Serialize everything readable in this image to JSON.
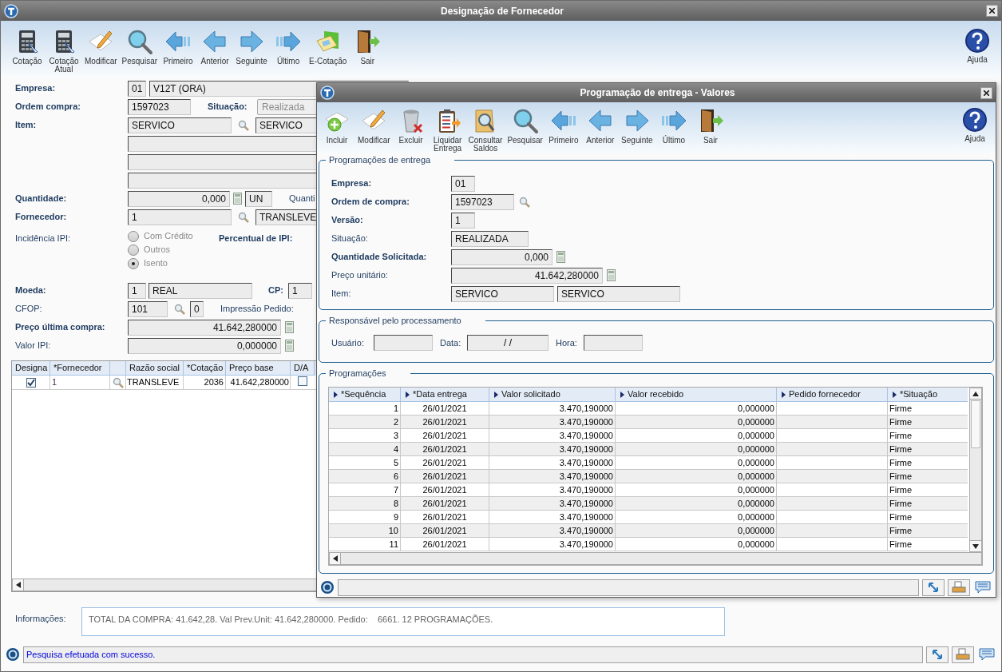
{
  "window": {
    "title": "Designação de Fornecedor"
  },
  "toolbar": [
    {
      "label": "Cotação",
      "kind": "calculator"
    },
    {
      "label": "Cotação\nAtual",
      "kind": "calculator"
    },
    {
      "label": "Modificar",
      "kind": "pencil"
    },
    {
      "label": "Pesquisar",
      "kind": "search"
    },
    {
      "label": "Primeiro",
      "kind": "first"
    },
    {
      "label": "Anterior",
      "kind": "previous"
    },
    {
      "label": "Seguinte",
      "kind": "next"
    },
    {
      "label": "Último",
      "kind": "last"
    },
    {
      "label": "E-Cotação",
      "kind": "folder"
    },
    {
      "label": "Sair",
      "kind": "exit"
    }
  ],
  "help": {
    "label": "Ajuda"
  },
  "form": {
    "empresa": {
      "label": "Empresa:",
      "required": true,
      "code": "01",
      "name": "V12T (ORA)"
    },
    "ordem": {
      "label": "Ordem compra:",
      "required": true,
      "value": "1597023"
    },
    "situacao": {
      "label": "Situação:",
      "required": true,
      "value": "Realizada"
    },
    "item": {
      "label": "Item:",
      "required": true,
      "code": "SERVICO",
      "name": "SERVICO"
    },
    "quantidade": {
      "label": "Quantidade:",
      "required": true,
      "value": "0,000",
      "unit": "UN",
      "next_label": "Quanti"
    },
    "fornecedor": {
      "label": "Fornecedor:",
      "required": true,
      "code": "1",
      "name": "TRANSLEVE"
    },
    "incidencia": {
      "label": "Incidência IPI:",
      "required": false,
      "options": [
        {
          "label": "Com Crédito",
          "selected": false
        },
        {
          "label": "Outros",
          "selected": false
        },
        {
          "label": "Isento",
          "selected": true
        }
      ]
    },
    "percentual": {
      "label": "Percentual de IPI:",
      "required": true
    },
    "moeda": {
      "label": "Moeda:",
      "required": true,
      "code": "1",
      "name": "REAL"
    },
    "cp": {
      "label": "CP:",
      "required": true,
      "value": "1"
    },
    "cfop": {
      "label": "CFOP:",
      "required": false,
      "code": "101",
      "digit": "0"
    },
    "impressao": {
      "label": "Impressão Pedido:",
      "required": false
    },
    "preco": {
      "label": "Preço última compra:",
      "required": true,
      "value": "41.642,280000"
    },
    "valor_ipi": {
      "label": "Valor IPI:",
      "required": false,
      "value": "0,000000"
    }
  },
  "grid": {
    "columns": [
      "Designa",
      "*Fornecedor",
      "",
      "Razão social",
      "*Cotação",
      "Preço base",
      "D/A"
    ],
    "rows": [
      {
        "designa": true,
        "fornecedor": "1",
        "razao": "TRANSLEVE",
        "cotacao": "2036",
        "preco": "41.642,280000",
        "da": false
      }
    ]
  },
  "info": {
    "label": "Informações:",
    "text": "TOTAL DA COMPRA: 41.642,28. Val Prev.Unit: 41.642,280000. Pedido:    6661. 12 PROGRAMAÇÕES."
  },
  "status_bar": {
    "message": "Pesquisa efetuada com sucesso."
  },
  "dialog": {
    "title": "Programação de entrega - Valores",
    "toolbar": [
      {
        "label": "Incluir",
        "kind": "add"
      },
      {
        "label": "Modificar",
        "kind": "pencil"
      },
      {
        "label": "Excluir",
        "kind": "delete"
      },
      {
        "label": "Liquidar\nEntrega",
        "kind": "clipboard"
      },
      {
        "label": "Consultar\nSaldos",
        "kind": "folder-search"
      },
      {
        "label": "Pesquisar",
        "kind": "search"
      },
      {
        "label": "Primeiro",
        "kind": "first"
      },
      {
        "label": "Anterior",
        "kind": "previous"
      },
      {
        "label": "Seguinte",
        "kind": "next"
      },
      {
        "label": "Último",
        "kind": "last"
      },
      {
        "label": "Sair",
        "kind": "exit"
      }
    ],
    "help": {
      "label": "Ajuda"
    },
    "entrega": {
      "title": "Programações de entrega",
      "empresa": {
        "label": "Empresa:",
        "required": true,
        "value": "01"
      },
      "ordem": {
        "label": "Ordem de compra:",
        "required": true,
        "value": "1597023"
      },
      "versao": {
        "label": "Versão:",
        "required": true,
        "value": "1"
      },
      "situacao": {
        "label": "Situação:",
        "required": false,
        "value": "REALIZADA"
      },
      "quantidade": {
        "label": "Quantidade Solicitada:",
        "required": true,
        "value": "0,000"
      },
      "preco": {
        "label": "Preço unitário:",
        "required": false,
        "value": "41.642,280000"
      },
      "item": {
        "label": "Item:",
        "required": false,
        "code": "SERVICO",
        "name": "SERVICO"
      }
    },
    "responsavel": {
      "title": "Responsável pelo processamento",
      "usuario": "Usuário:",
      "data": "Data:",
      "data_value": "/ /",
      "hora": "Hora:"
    },
    "programacoes": {
      "title": "Programações",
      "columns": [
        "*Sequência",
        "*Data entrega",
        "Valor solicitado",
        "Valor recebido",
        "Pedido fornecedor",
        "*Situação"
      ],
      "rows": [
        {
          "seq": "1",
          "data": "26/01/2021",
          "solicitado": "3.470,190000",
          "recebido": "0,000000",
          "situacao": "Firme"
        },
        {
          "seq": "2",
          "data": "26/01/2021",
          "solicitado": "3.470,190000",
          "recebido": "0,000000",
          "situacao": "Firme"
        },
        {
          "seq": "3",
          "data": "26/01/2021",
          "solicitado": "3.470,190000",
          "recebido": "0,000000",
          "situacao": "Firme"
        },
        {
          "seq": "4",
          "data": "26/01/2021",
          "solicitado": "3.470,190000",
          "recebido": "0,000000",
          "situacao": "Firme"
        },
        {
          "seq": "5",
          "data": "26/01/2021",
          "solicitado": "3.470,190000",
          "recebido": "0,000000",
          "situacao": "Firme"
        },
        {
          "seq": "6",
          "data": "26/01/2021",
          "solicitado": "3.470,190000",
          "recebido": "0,000000",
          "situacao": "Firme"
        },
        {
          "seq": "7",
          "data": "26/01/2021",
          "solicitado": "3.470,190000",
          "recebido": "0,000000",
          "situacao": "Firme"
        },
        {
          "seq": "8",
          "data": "26/01/2021",
          "solicitado": "3.470,190000",
          "recebido": "0,000000",
          "situacao": "Firme"
        },
        {
          "seq": "9",
          "data": "26/01/2021",
          "solicitado": "3.470,190000",
          "recebido": "0,000000",
          "situacao": "Firme"
        },
        {
          "seq": "10",
          "data": "26/01/2021",
          "solicitado": "3.470,190000",
          "recebido": "0,000000",
          "situacao": "Firme"
        },
        {
          "seq": "11",
          "data": "26/01/2021",
          "solicitado": "3.470,190000",
          "recebido": "0,000000",
          "situacao": "Firme"
        }
      ]
    }
  }
}
